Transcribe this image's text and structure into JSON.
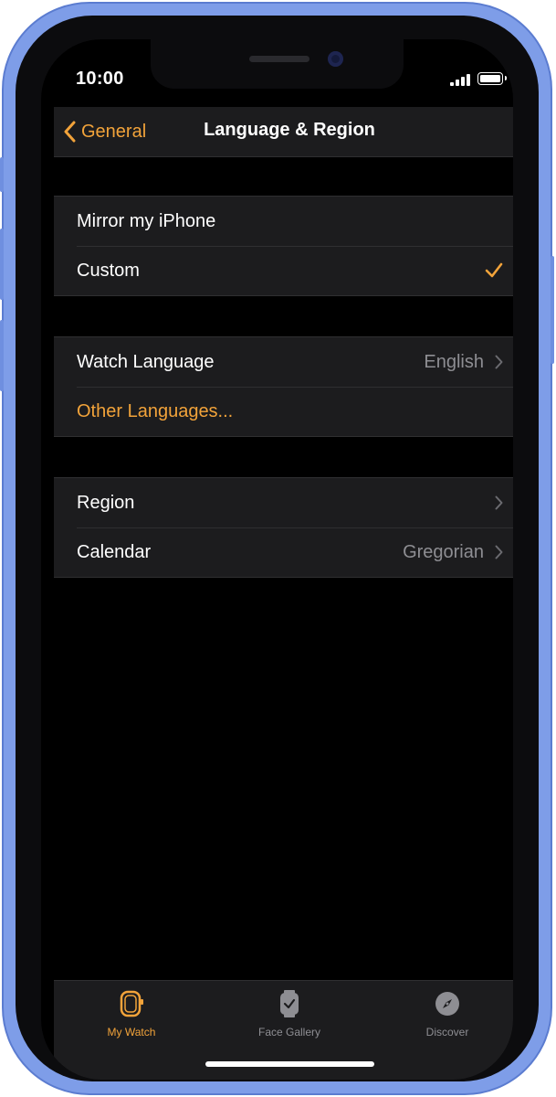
{
  "status_bar": {
    "time": "10:00"
  },
  "nav": {
    "back_label": "General",
    "title": "Language & Region"
  },
  "mode_group": {
    "items": [
      {
        "label": "Mirror my iPhone",
        "selected": false
      },
      {
        "label": "Custom",
        "selected": true
      }
    ]
  },
  "language_group": {
    "watch_language": {
      "label": "Watch Language",
      "value": "English"
    },
    "other_languages": {
      "label": "Other Languages..."
    }
  },
  "region_group": {
    "region": {
      "label": "Region",
      "value": ""
    },
    "calendar": {
      "label": "Calendar",
      "value": "Gregorian"
    }
  },
  "tab_bar": {
    "tabs": [
      {
        "label": "My Watch",
        "icon": "my-watch-icon",
        "active": true
      },
      {
        "label": "Face Gallery",
        "icon": "face-gallery-icon",
        "active": false
      },
      {
        "label": "Discover",
        "icon": "compass-icon",
        "active": false
      }
    ]
  },
  "colors": {
    "accent": "#f2a33a",
    "background": "#000000",
    "cell": "#1c1c1e",
    "secondary_text": "#8e8e93",
    "device_frame": "#7e9de8"
  }
}
